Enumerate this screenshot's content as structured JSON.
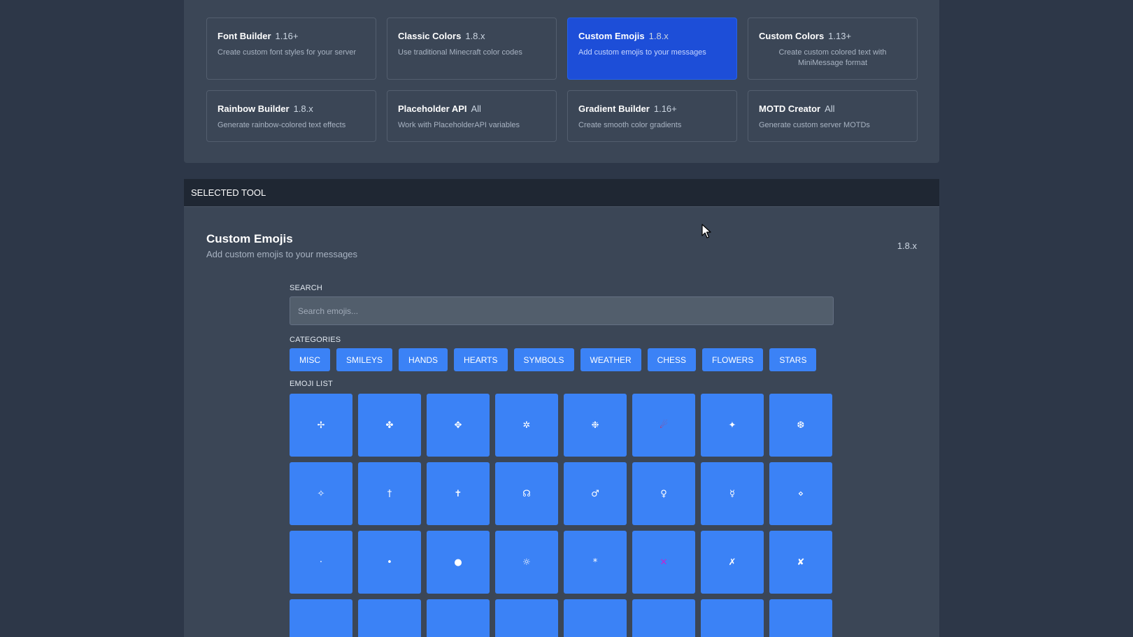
{
  "tools": [
    {
      "name": "Font Builder",
      "version": "1.16+",
      "desc": "Create custom font styles for your server"
    },
    {
      "name": "Classic Colors",
      "version": "1.8.x",
      "desc": "Use traditional Minecraft color codes"
    },
    {
      "name": "Custom Emojis",
      "version": "1.8.x",
      "desc": "Add custom emojis to your messages"
    },
    {
      "name": "Custom Colors",
      "version": "1.13+",
      "desc": "Create custom colored text with MiniMessage format"
    },
    {
      "name": "Rainbow Builder",
      "version": "1.8.x",
      "desc": "Generate rainbow-colored text effects"
    },
    {
      "name": "Placeholder API",
      "version": "All",
      "desc": "Work with PlaceholderAPI variables"
    },
    {
      "name": "Gradient Builder",
      "version": "1.16+",
      "desc": "Create smooth color gradients"
    },
    {
      "name": "MOTD Creator",
      "version": "All",
      "desc": "Generate custom server MOTDs"
    }
  ],
  "selected_section": {
    "header": "SELECTED TOOL",
    "title": "Custom Emojis",
    "subtitle": "Add custom emojis to your messages",
    "version": "1.8.x"
  },
  "search": {
    "label": "SEARCH",
    "placeholder": "Search emojis..."
  },
  "categories": {
    "label": "CATEGORIES",
    "items": [
      "MISC",
      "SMILEYS",
      "HANDS",
      "HEARTS",
      "SYMBOLS",
      "WEATHER",
      "CHESS",
      "FLOWERS",
      "STARS"
    ]
  },
  "emoji_list": {
    "label": "EMOJI LIST",
    "items": [
      "✢",
      "✤",
      "✥",
      "✲",
      "❉",
      "☄",
      "✦",
      "❆",
      "✧",
      "†",
      "✝",
      "☊",
      "♂",
      "♀",
      "☿",
      "⋄",
      "·",
      "•",
      "●",
      "☼",
      "*",
      "✕",
      "✗",
      "✘",
      "",
      "",
      "",
      "",
      "",
      "",
      "",
      ""
    ]
  },
  "colors": {
    "background": "#2d3748",
    "panel": "#3b4656",
    "accent": "#3b82f6",
    "selected_card": "#1d4ed8"
  }
}
